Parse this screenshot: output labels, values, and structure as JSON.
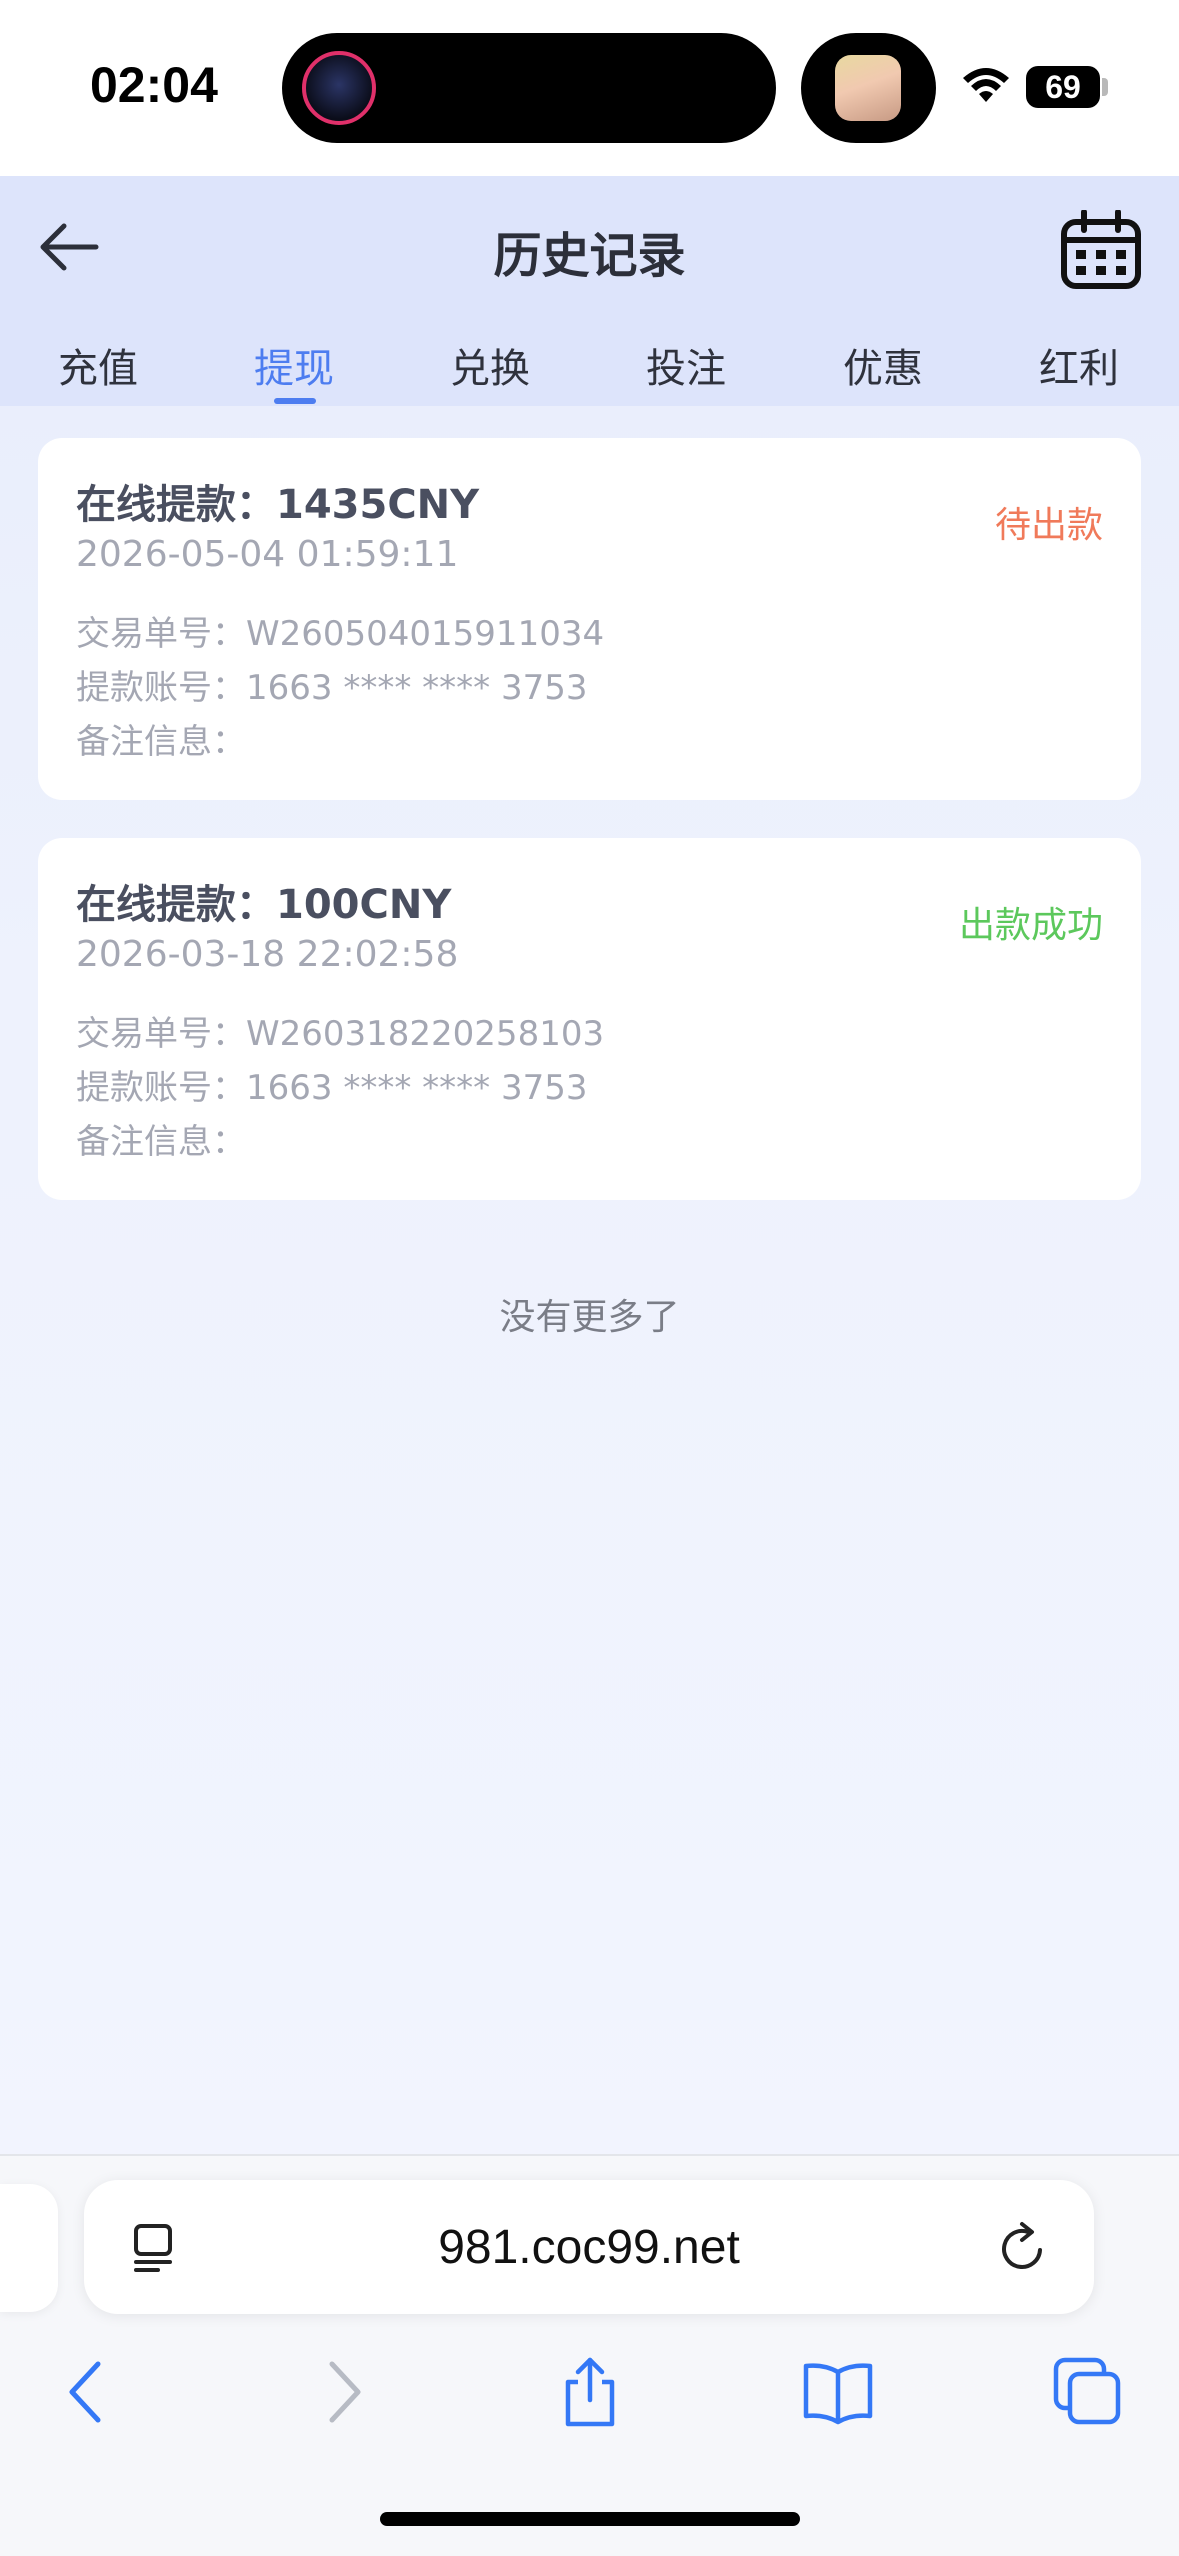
{
  "status_bar": {
    "time": "02:04",
    "battery": "69"
  },
  "header": {
    "title": "历史记录",
    "tabs": [
      {
        "label": "充值",
        "active": false
      },
      {
        "label": "提现",
        "active": true
      },
      {
        "label": "兑换",
        "active": false
      },
      {
        "label": "投注",
        "active": false
      },
      {
        "label": "优惠",
        "active": false
      },
      {
        "label": "红利",
        "active": false
      }
    ]
  },
  "records": [
    {
      "title_label": "在线提款：",
      "amount": "1435CNY",
      "status": "待出款",
      "status_color": "#f07a5a",
      "datetime": "2026-05-04 01:59:11",
      "txn_label": "交易单号：",
      "txn_no": "W260504015911034",
      "account_label": "提款账号：",
      "account_no": "1663 **** **** 3753",
      "note_label": "备注信息："
    },
    {
      "title_label": "在线提款：",
      "amount": "100CNY",
      "status": "出款成功",
      "status_color": "#5cc85c",
      "datetime": "2026-03-18 22:02:58",
      "txn_label": "交易单号：",
      "txn_no": "W260318220258103",
      "account_label": "提款账号：",
      "account_no": "1663 **** **** 3753",
      "note_label": "备注信息："
    }
  ],
  "footer_text": "没有更多了",
  "browser": {
    "url": "981.coc99.net"
  },
  "colors": {
    "accent": "#4d7df0",
    "header_bg": "#dde4fb",
    "ios_blue": "#3478f6"
  }
}
